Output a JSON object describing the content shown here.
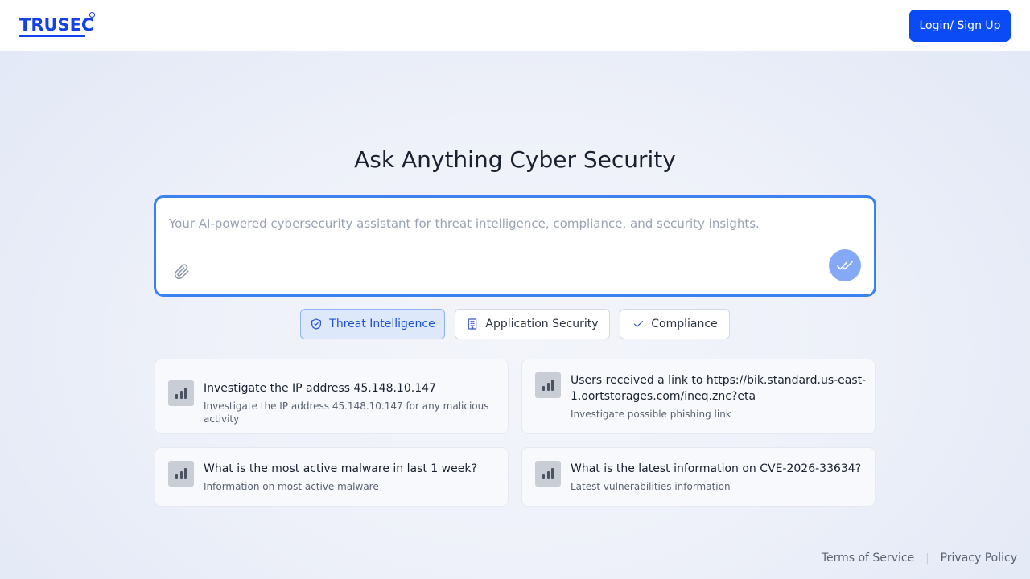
{
  "header": {
    "logo_text": "TRUSEC",
    "login_label": "Login/ Sign Up"
  },
  "main": {
    "title": "Ask Anything Cyber Security",
    "prompt": {
      "placeholder": "Your AI-powered cybersecurity assistant for threat intelligence, compliance, and security insights.",
      "value": ""
    },
    "chips": [
      {
        "label": "Threat Intelligence",
        "icon": "shield-icon",
        "active": true
      },
      {
        "label": "Application Security",
        "icon": "building-icon",
        "active": false
      },
      {
        "label": "Compliance",
        "icon": "check-icon",
        "active": false
      }
    ],
    "cards": [
      {
        "title": "Investigate the IP address 45.148.10.147",
        "subtitle": "Investigate the IP address 45.148.10.147 for any malicious activity",
        "icon": "bar-chart-icon"
      },
      {
        "title_line1": "Users received a link to https://bik.standard.us-east-",
        "title_line2": "1.oortstorages.com/ineq.znc?eta",
        "subtitle": "Investigate possible phishing link",
        "icon": "bar-chart-icon"
      },
      {
        "title": "What is the most active malware in last 1 week?",
        "subtitle": "Information on most active malware",
        "icon": "bar-chart-icon"
      },
      {
        "title": "What is the latest information on CVE-2026-33634?",
        "subtitle": "Latest vulnerabilities information",
        "icon": "bar-chart-icon"
      }
    ]
  },
  "footer": {
    "terms_label": "Terms of Service",
    "privacy_label": "Privacy Policy"
  },
  "colors": {
    "brand": "#1540e8",
    "primary_button": "#0b4bf5",
    "input_border": "#3b82ef",
    "active_chip_bg": "#dde9fb"
  }
}
